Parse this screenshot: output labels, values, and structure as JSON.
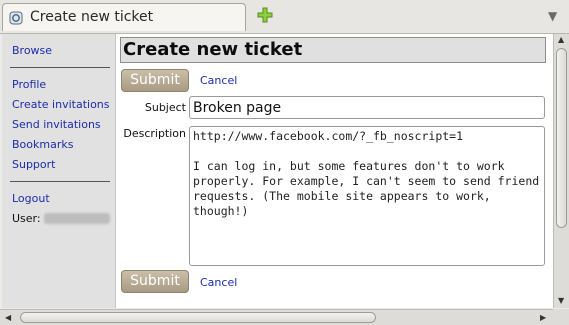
{
  "tabs": [
    {
      "title": "Create new ticket",
      "icon": "page-icon"
    }
  ],
  "new_tab_icon": "plus-icon",
  "tab_list_icon": "chevron-down-icon",
  "sidebar": {
    "browse": "Browse",
    "profile": "Profile",
    "create_invitations": "Create invitations",
    "send_invitations": "Send invitations",
    "bookmarks": "Bookmarks",
    "support": "Support",
    "logout": "Logout",
    "user_label": "User:"
  },
  "page": {
    "title": "Create new ticket",
    "submit_label": "Submit",
    "cancel_label": "Cancel",
    "subject_label": "Subject",
    "subject_value": "Broken page",
    "description_label": "Description",
    "description_value": "http://www.facebook.com/?_fb_noscript=1\n\nI can log in, but some features don't to work properly. For example, I can't seem to send friend requests. (The mobile site appears to work, though!)"
  },
  "colors": {
    "link": "#1c2ca8",
    "button": "#b3a690",
    "sidebar_bg": "#e1e1e1",
    "heading_bg": "#e0e0e0"
  }
}
